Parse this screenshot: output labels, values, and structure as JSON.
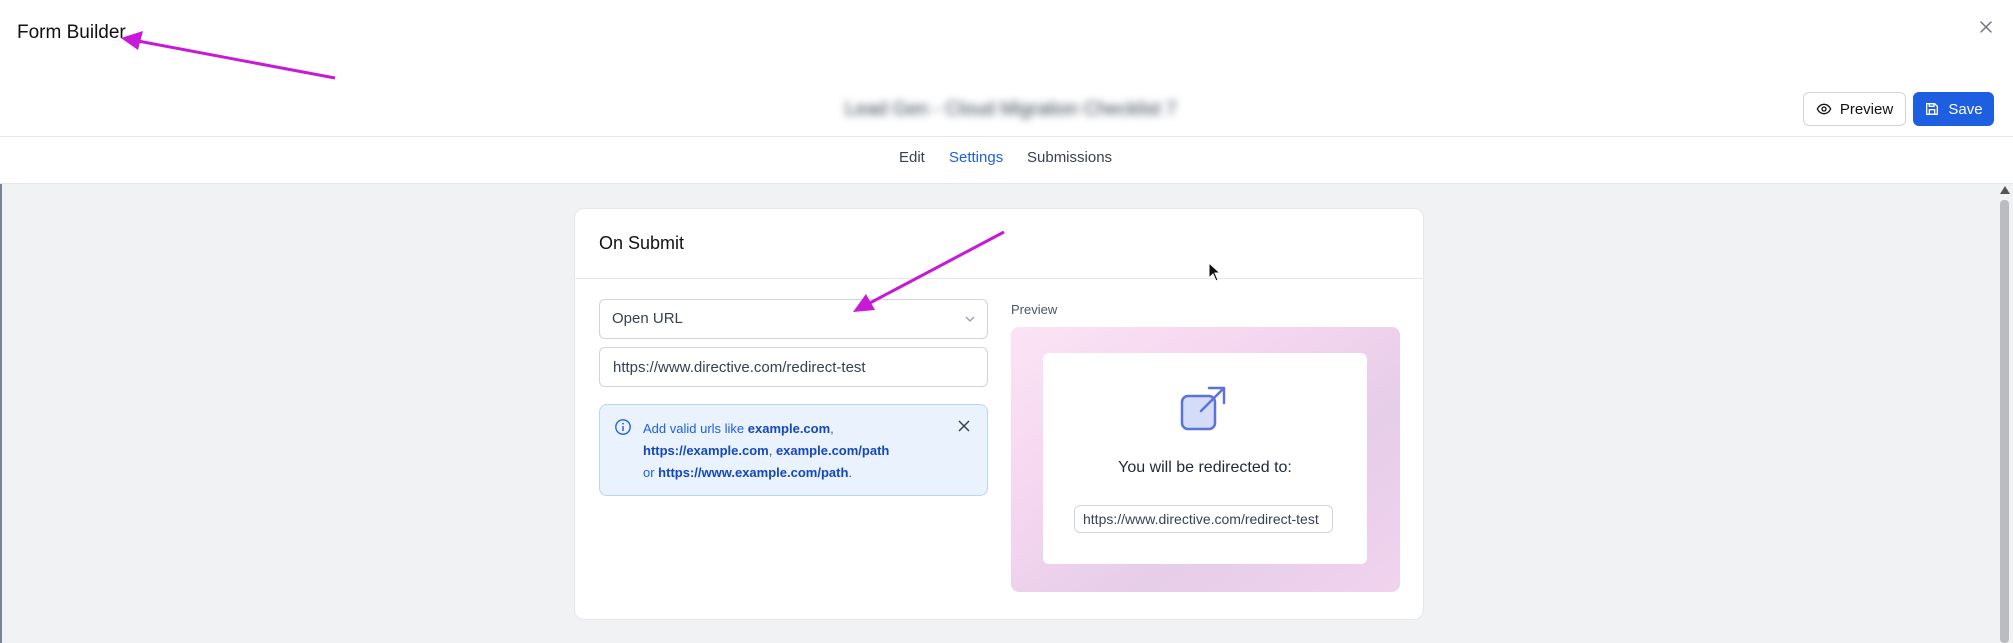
{
  "window": {
    "title": "Form Builder",
    "close_label": "×"
  },
  "header": {
    "form_name": "Lead Gen - Cloud Migration Checklist 7",
    "preview_label": "Preview",
    "save_label": "Save"
  },
  "tabs": [
    {
      "label": "Edit",
      "active": false
    },
    {
      "label": "Settings",
      "active": true
    },
    {
      "label": "Submissions",
      "active": false
    }
  ],
  "card": {
    "title": "On Submit",
    "action_select": {
      "value": "Open URL"
    },
    "url_input": {
      "value": "https://www.directive.com/redirect-test"
    },
    "info": {
      "prefix": "Add valid urls like ",
      "ex1": "example.com",
      "sep1": ", ",
      "ex2": "https://example.com",
      "sep2": ", ",
      "ex3": "example.com/path",
      "mid": " or ",
      "ex4": "https://www.example.com/path",
      "suffix": "."
    },
    "preview": {
      "label": "Preview",
      "redirect_text": "You will be redirected to:",
      "url": "https://www.directive.com/redirect-test"
    }
  },
  "colors": {
    "accent": "#1d5fe0",
    "annotation": "#c81ad6",
    "info_bg": "#eaf2fd"
  },
  "icons": [
    "close-icon",
    "eye-icon",
    "save-icon",
    "chevron-down-icon",
    "info-icon",
    "external-link-icon",
    "cursor-icon"
  ]
}
